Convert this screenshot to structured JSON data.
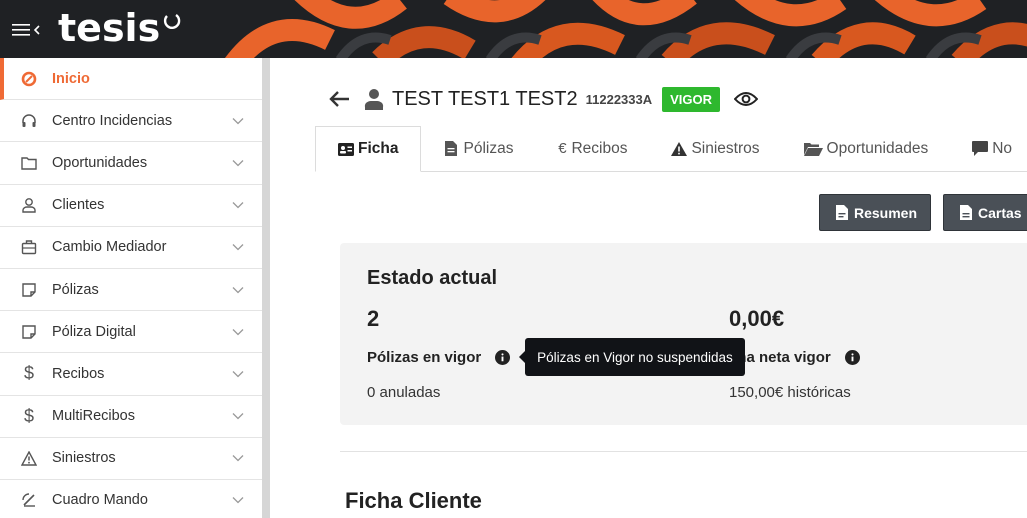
{
  "app": {
    "logo_text": "tesis"
  },
  "sidebar": {
    "items": [
      {
        "label": "Inicio",
        "icon": "tesis-logo-icon",
        "active": true
      },
      {
        "label": "Centro Incidencias",
        "icon": "headset-icon"
      },
      {
        "label": "Oportunidades",
        "icon": "folder-icon"
      },
      {
        "label": "Clientes",
        "icon": "user-icon"
      },
      {
        "label": "Cambio Mediador",
        "icon": "briefcase-icon"
      },
      {
        "label": "Pólizas",
        "icon": "document-icon"
      },
      {
        "label": "Póliza Digital",
        "icon": "document-icon"
      },
      {
        "label": "Recibos",
        "icon": "dollar-icon"
      },
      {
        "label": "MultiRecibos",
        "icon": "dollar-icon"
      },
      {
        "label": "Siniestros",
        "icon": "warning-icon"
      },
      {
        "label": "Cuadro Mando",
        "icon": "dashboard-icon"
      }
    ]
  },
  "client": {
    "name": "TEST TEST1 TEST2",
    "id": "11222333A",
    "status": "VIGOR"
  },
  "tabs": [
    {
      "label": "Ficha",
      "icon": "id-card-icon",
      "active": true
    },
    {
      "label": "Pólizas",
      "icon": "file-icon"
    },
    {
      "label": "Recibos",
      "icon": "euro-icon"
    },
    {
      "label": "Siniestros",
      "icon": "warning-icon"
    },
    {
      "label": "Oportunidades",
      "icon": "folder-open-icon"
    },
    {
      "label": "No",
      "icon": "comment-icon"
    }
  ],
  "actions": {
    "resumen_label": "Resumen",
    "cartas_label": "Cartas"
  },
  "estado": {
    "title": "Estado actual",
    "polizas_value": "2",
    "polizas_label": "Pólizas en vigor",
    "polizas_sub": "0 anuladas",
    "prima_value": "0,00€",
    "prima_label": "ima neta vigor",
    "prima_sub": "150,00€ históricas"
  },
  "tooltip": {
    "text": "Pólizas en Vigor no suspendidas"
  },
  "section": {
    "title": "Ficha Cliente"
  },
  "colors": {
    "accent": "#ef6a35",
    "header": "#1f2124",
    "badge": "#2eb82e",
    "button": "#4a5057"
  }
}
